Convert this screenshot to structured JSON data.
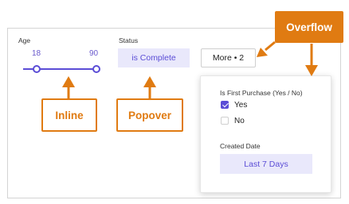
{
  "filters": {
    "age": {
      "label": "Age",
      "min": "18",
      "max": "90"
    },
    "status": {
      "label": "Status",
      "value": "is Complete"
    },
    "more_button": "More • 2"
  },
  "overflow_menu": {
    "first_purchase": {
      "label": "Is First Purchase (Yes / No)",
      "options": [
        {
          "label": "Yes",
          "checked": true
        },
        {
          "label": "No",
          "checked": false
        }
      ]
    },
    "created_date": {
      "label": "Created Date",
      "value": "Last 7 Days"
    }
  },
  "callouts": {
    "inline": "Inline",
    "popover": "Popover",
    "overflow": "Overflow"
  },
  "colors": {
    "accent": "#5b4dd6",
    "callout": "#e07b12",
    "chip_bg": "#e9e8fb"
  }
}
